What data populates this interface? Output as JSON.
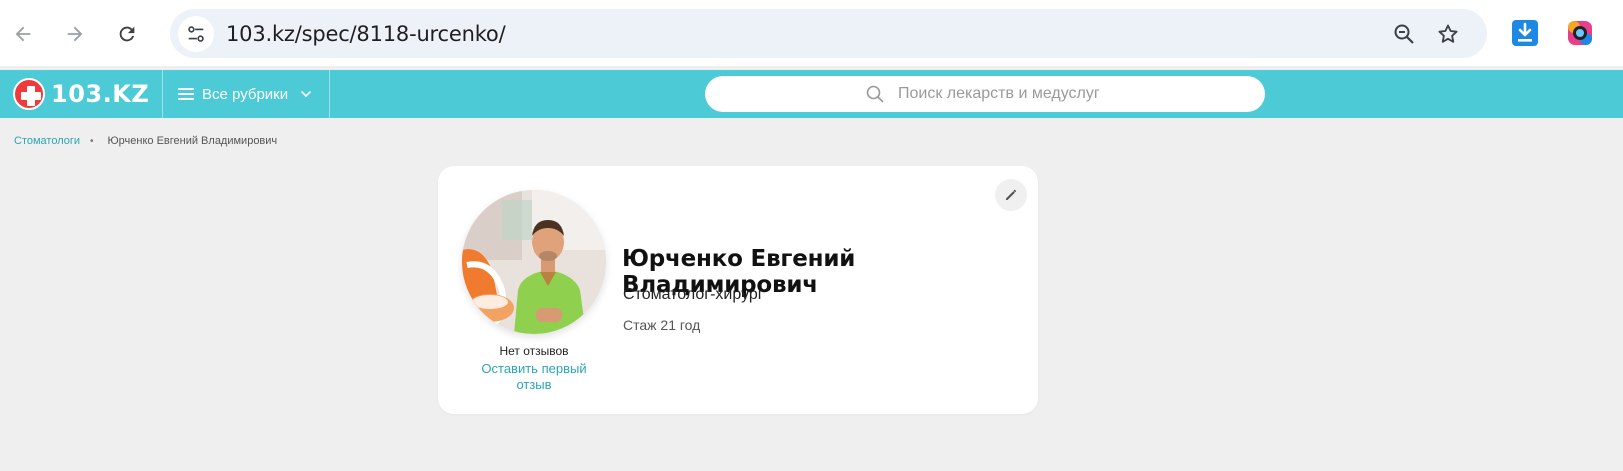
{
  "browser": {
    "url": "103.kz/spec/8118-urcenko/"
  },
  "site": {
    "logo_text": "103.KZ",
    "rubrics_label": "Все рубрики",
    "search_placeholder": "Поиск лекарств и медуслуг",
    "brand_color": "#4ccbd6",
    "link_color": "#2aa6b3"
  },
  "breadcrumb": {
    "category": "Стоматологи",
    "separator": "•",
    "current": "Юрченко Евгений Владимирович"
  },
  "doctor": {
    "name": "Юрченко Евгений Владимирович",
    "specialty": "Стоматолог-хирург",
    "experience": "Стаж 21 год",
    "no_reviews": "Нет отзывов",
    "leave_review": "Оставить первый отзыв"
  },
  "icons": {
    "back": "arrow-left-icon",
    "forward": "arrow-right-icon",
    "reload": "reload-icon",
    "site_info": "tune-icon",
    "zoom": "zoom-out-icon",
    "bookmark": "star-icon",
    "download_ext": "download-icon",
    "camera_ext": "camera-icon",
    "menu": "hamburger-icon",
    "chevron": "chevron-down-icon",
    "search": "search-icon",
    "edit": "pencil-icon"
  }
}
